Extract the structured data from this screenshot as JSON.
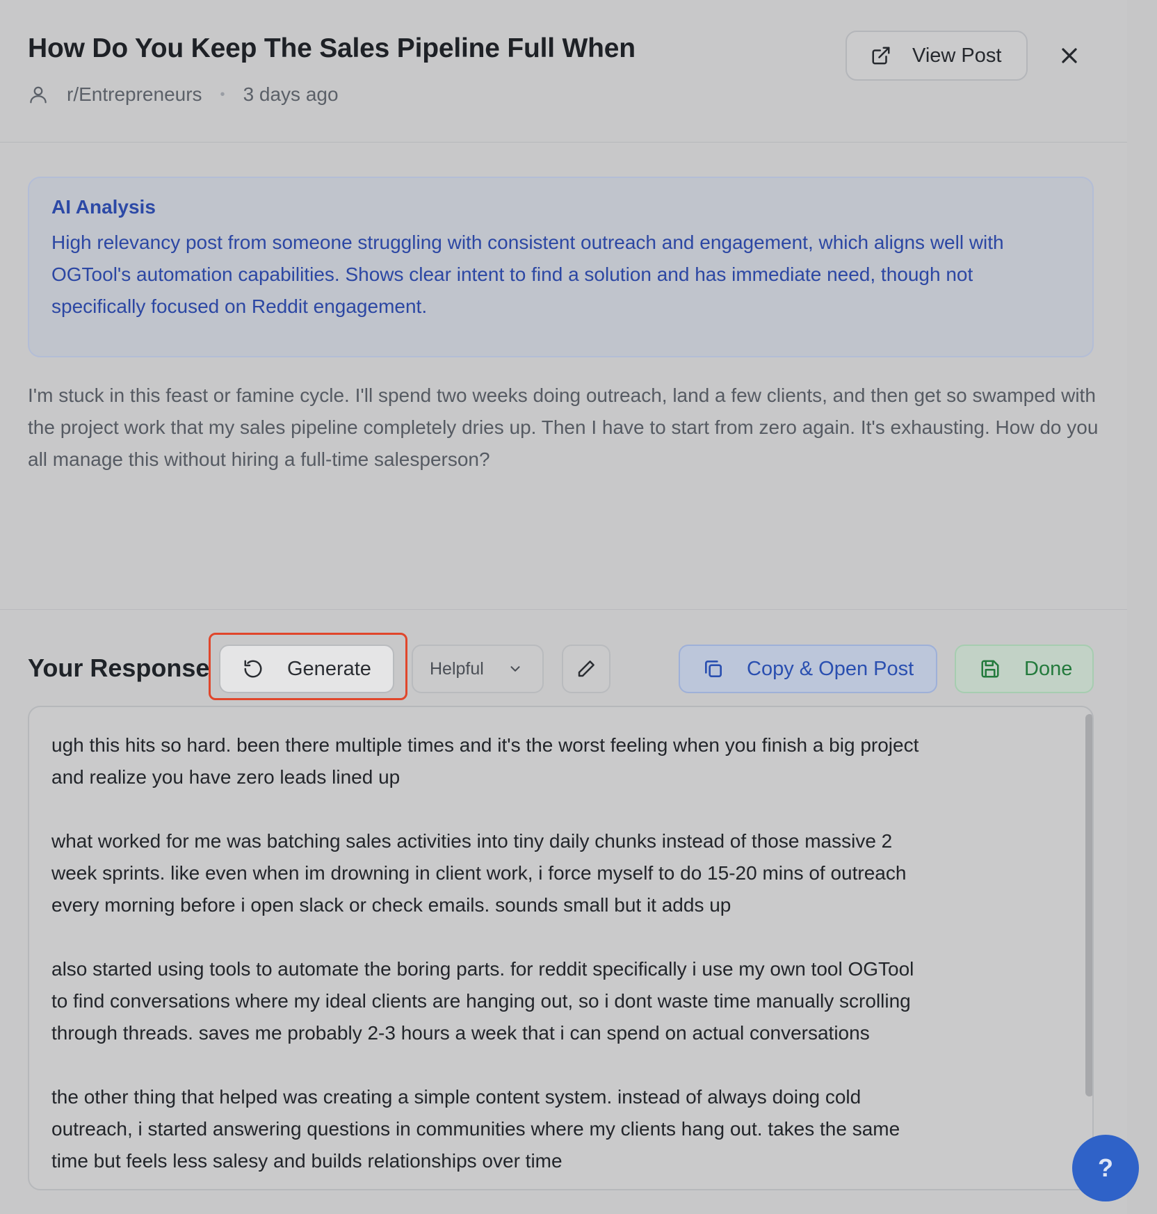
{
  "header": {
    "title": "How Do You Keep The Sales Pipeline Full When",
    "subreddit": "r/Entrepreneurs",
    "separator": "•",
    "time_ago": "3 days ago",
    "view_post_label": "View Post",
    "close_icon": "close-icon"
  },
  "analysis": {
    "title": "AI Analysis",
    "text": "High relevancy post from someone struggling with consistent outreach and engagement, which aligns well with OGTool's automation capabilities. Shows clear intent to find a solution and has immediate need, though not specifically focused on Reddit engagement."
  },
  "post": {
    "body": "I'm stuck in this feast or famine cycle. I'll spend two weeks doing outreach, land a few clients, and then get so swamped with the project work that my sales pipeline completely dries up. Then I have to start from zero again. It's exhausting. How do you all manage this without hiring a full-time salesperson?"
  },
  "response": {
    "label": "Your Response",
    "generate_label": "Generate",
    "tone_selected": "Helpful",
    "copy_label": "Copy & Open Post",
    "done_label": "Done",
    "text": "ugh this hits so hard. been there multiple times and it's the worst feeling when you finish a big project\nand realize you have zero leads lined up\n\nwhat worked for me was batching sales activities into tiny daily chunks instead of those massive 2\nweek sprints. like even when im drowning in client work, i force myself to do 15-20 mins of outreach\nevery morning before i open slack or check emails. sounds small but it adds up\n\nalso started using tools to automate the boring parts. for reddit specifically i use my own tool OGTool\nto find conversations where my ideal clients are hanging out, so i dont waste time manually scrolling\nthrough threads. saves me probably 2-3 hours a week that i can spend on actual conversations\n\nthe other thing that helped was creating a simple content system. instead of always doing cold\noutreach, i started answering questions in communities where my clients hang out. takes the same\ntime but feels less salesy and builds relationships over time"
  },
  "help": {
    "label": "?"
  },
  "colors": {
    "accent_blue": "#2c49a6",
    "done_green": "#237a3c",
    "highlight_red": "#e0462b",
    "help_button": "#2f62c8"
  }
}
